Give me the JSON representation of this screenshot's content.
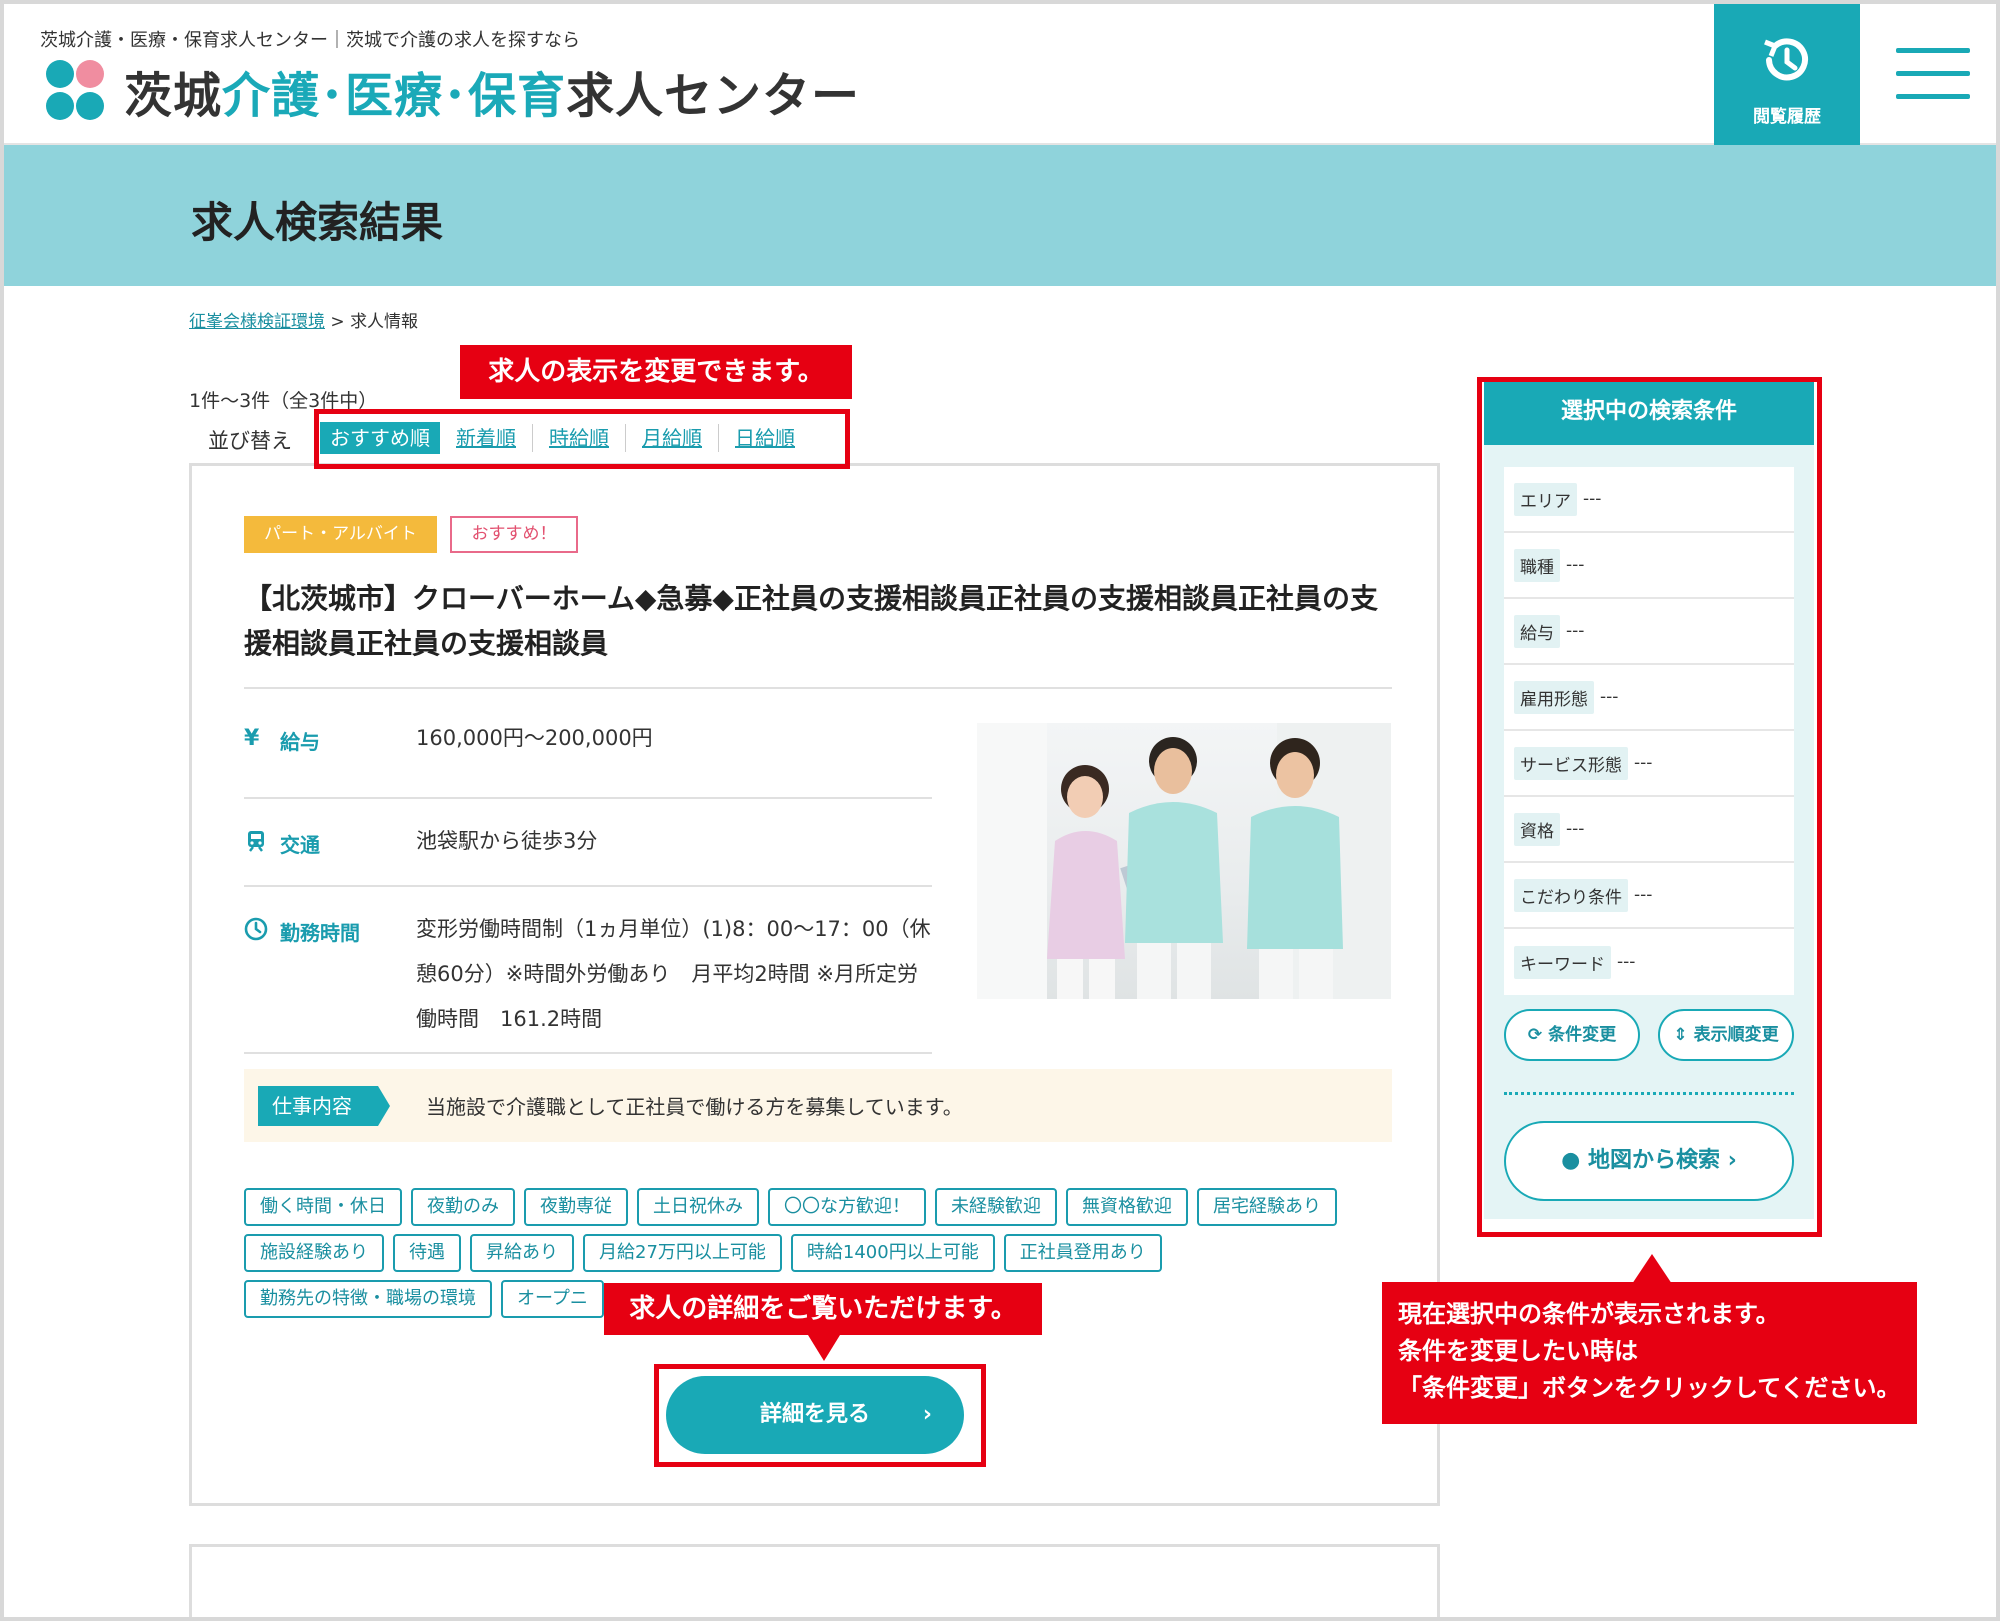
{
  "header": {
    "tagline": "茨城介護・医療・保育求人センター｜茨城で介護の求人を探すなら",
    "logo_part1": "茨城",
    "logo_part2": "介護･医療･保育",
    "logo_part3": "求人センター",
    "history_label": "閲覧履歴"
  },
  "page_title": "求人検索結果",
  "breadcrumb": {
    "home": "征峯会様検証環境",
    "separator": " > ",
    "current": "求人情報"
  },
  "results": {
    "count": "1件〜3件（全3件中）",
    "sort_label": "並び替え",
    "sort_options": [
      "おすすめ順",
      "新着順",
      "時給順",
      "月給順",
      "日給順"
    ]
  },
  "job": {
    "badge_type": "パート・アルバイト",
    "badge_rec": "おすすめ！",
    "title": "【北茨城市】クローバーホーム◆急募◆正社員の支援相談員正社員の支援相談員正社員の支援相談員正社員の支援相談員",
    "salary_label": "給与",
    "salary": "160,000円〜200,000円",
    "transport_label": "交通",
    "transport": "池袋駅から徒歩3分",
    "hours_label": "勤務時間",
    "hours": "変形労働時間制（1ヵ月単位）(1)8：00〜17：00（休憩60分）※時間外労働あり　月平均2時間 ※月所定労働時間　161.2時間",
    "work_label": "仕事内容",
    "work_text": "当施設で介護職として正社員で働ける方を募集しています。",
    "tags": [
      "働く時間・休日",
      "夜勤のみ",
      "夜勤専従",
      "土日祝休み",
      "〇〇な方歓迎！",
      "未経験歓迎",
      "無資格歓迎",
      "居宅経験あり",
      "施設経験あり",
      "待遇",
      "昇給あり",
      "月給27万円以上可能",
      "時給1400円以上可能",
      "正社員登用あり",
      "勤務先の特徴・職場の環境",
      "オープニ"
    ],
    "detail_button": "詳細を見る"
  },
  "sidebar": {
    "title": "選択中の検索条件",
    "conditions": [
      {
        "key": "エリア",
        "value": "---"
      },
      {
        "key": "職種",
        "value": "---"
      },
      {
        "key": "給与",
        "value": "---"
      },
      {
        "key": "雇用形態",
        "value": "---"
      },
      {
        "key": "サービス形態",
        "value": "---"
      },
      {
        "key": "資格",
        "value": "---"
      },
      {
        "key": "こだわり条件",
        "value": "---"
      },
      {
        "key": "キーワード",
        "value": "---"
      }
    ],
    "change_button": "条件変更",
    "order_button": "表示順変更",
    "map_button": "地図から検索"
  },
  "annotations": {
    "sort_note": "求人の表示を変更できます。",
    "detail_note": "求人の詳細をご覧いただけます。",
    "side_note_1": "現在選択中の条件が表示されます。",
    "side_note_2": "条件を変更したい時は",
    "side_note_3": "「条件変更」ボタンをクリックしてください。"
  },
  "colors": {
    "teal": "#19a9b6",
    "band": "#8fd3db",
    "annotation_red": "#e60012",
    "badge_orange": "#f4ba3c"
  }
}
